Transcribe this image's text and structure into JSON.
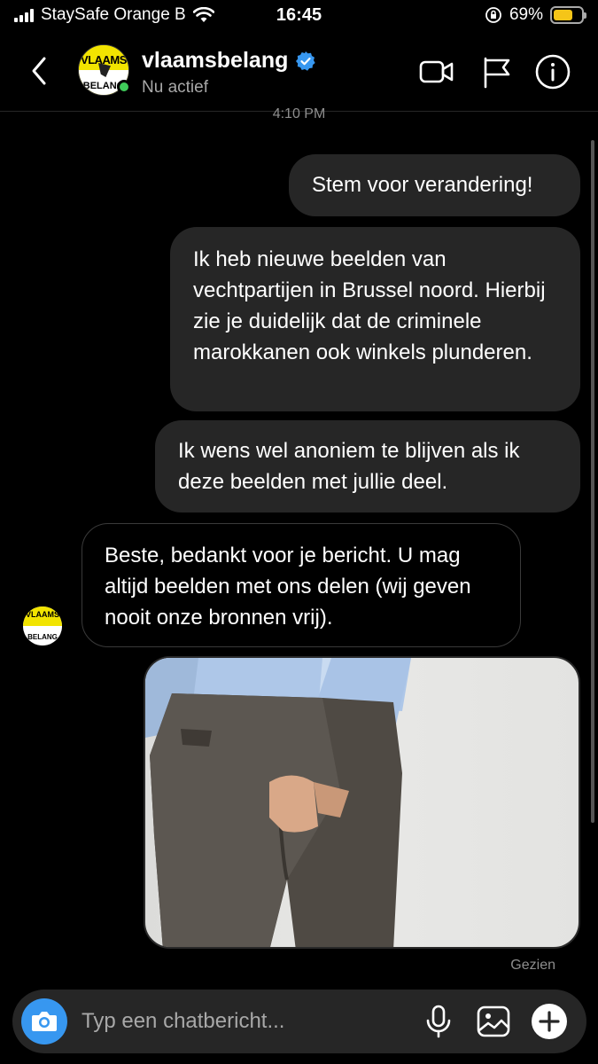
{
  "status_bar": {
    "carrier": "StaySafe Orange B",
    "time": "16:45",
    "battery_percent": "69%",
    "battery_level": 0.69
  },
  "header": {
    "name": "vlaamsbelang",
    "status": "Nu actief",
    "avatar_text_top": "VLAAMS",
    "avatar_text_bottom": "BELANG",
    "icons": [
      "back-icon",
      "video-call-icon",
      "flag-icon",
      "info-icon"
    ]
  },
  "chat": {
    "timestamp": "4:10 PM",
    "messages": [
      {
        "direction": "outgoing",
        "text": "Stem voor verandering!"
      },
      {
        "direction": "outgoing",
        "text": "Ik heb nieuwe beelden van vechtpartijen in Brussel noord. Hierbij zie je duidelijk dat de criminele marokkanen ook winkels plunderen."
      },
      {
        "direction": "outgoing",
        "text": "Ik wens wel anoniem te blijven als ik deze beelden met jullie deel."
      },
      {
        "direction": "incoming",
        "text": "Beste, bedankt voor je bericht. U mag altijd beelden met ons delen (wij geven nooit onze bronnen vrij)."
      }
    ],
    "seen_label": "Gezien"
  },
  "composer": {
    "placeholder": "Typ een chatbericht...",
    "icons": [
      "camera-icon",
      "microphone-icon",
      "gallery-icon",
      "plus-icon"
    ]
  },
  "colors": {
    "accent": "#3797f0",
    "online": "#3fcc5a",
    "battery": "#f5c518",
    "bubble_outgoing": "#262626"
  }
}
